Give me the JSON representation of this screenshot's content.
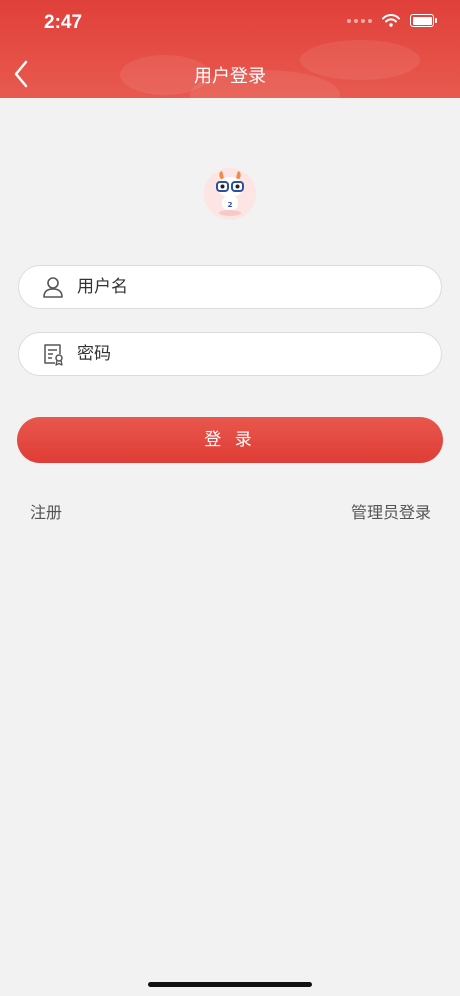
{
  "status_bar": {
    "time": "2:47"
  },
  "nav": {
    "title": "用户登录"
  },
  "form": {
    "username_placeholder": "用户名",
    "password_placeholder": "密码",
    "login_label": "登 录"
  },
  "links": {
    "register": "注册",
    "admin_login": "管理员登录"
  },
  "colors": {
    "brand_red": "#e0403a",
    "background": "#f2f2f2"
  }
}
